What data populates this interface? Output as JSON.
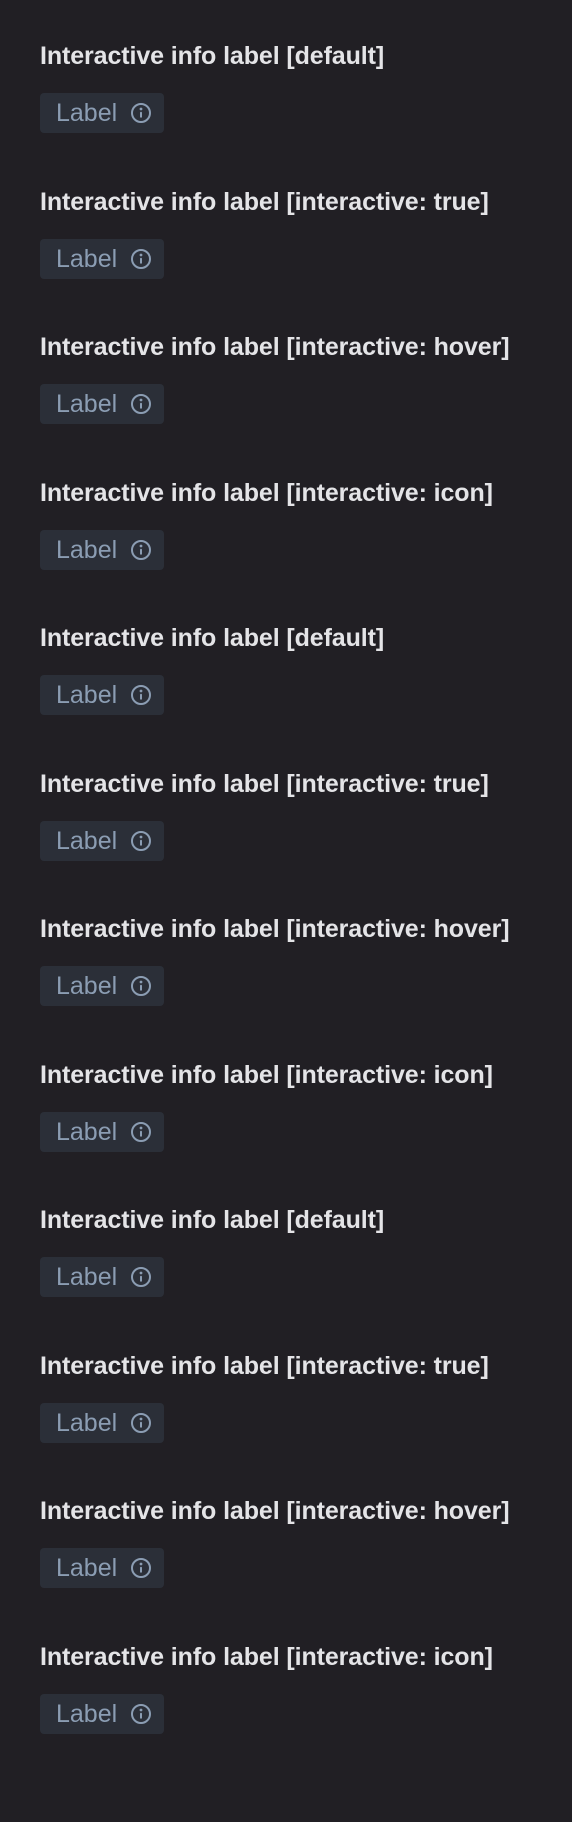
{
  "sections": [
    {
      "heading": "Interactive info label [default]",
      "chip_label": "Label",
      "icon": "info-icon"
    },
    {
      "heading": "Interactive info label [interactive: true]",
      "chip_label": "Label",
      "icon": "info-icon"
    },
    {
      "heading": "Interactive info label [interactive: hover]",
      "chip_label": "Label",
      "icon": "info-icon"
    },
    {
      "heading": "Interactive info label [interactive: icon]",
      "chip_label": "Label",
      "icon": "info-icon"
    },
    {
      "heading": "Interactive info label [default]",
      "chip_label": "Label",
      "icon": "info-icon"
    },
    {
      "heading": "Interactive info label [interactive: true]",
      "chip_label": "Label",
      "icon": "info-icon"
    },
    {
      "heading": "Interactive info label [interactive: hover]",
      "chip_label": "Label",
      "icon": "info-icon"
    },
    {
      "heading": "Interactive info label [interactive: icon]",
      "chip_label": "Label",
      "icon": "info-icon"
    },
    {
      "heading": "Interactive info label [default]",
      "chip_label": "Label",
      "icon": "info-icon"
    },
    {
      "heading": "Interactive info label [interactive: true]",
      "chip_label": "Label",
      "icon": "info-icon"
    },
    {
      "heading": "Interactive info label [interactive: hover]",
      "chip_label": "Label",
      "icon": "info-icon"
    },
    {
      "heading": "Interactive info label [interactive: icon]",
      "chip_label": "Label",
      "icon": "info-icon"
    }
  ],
  "colors": {
    "background": "#211f24",
    "heading_text": "#e4e4e7",
    "chip_background": "#2b2f38",
    "chip_text": "#8b9db3"
  }
}
